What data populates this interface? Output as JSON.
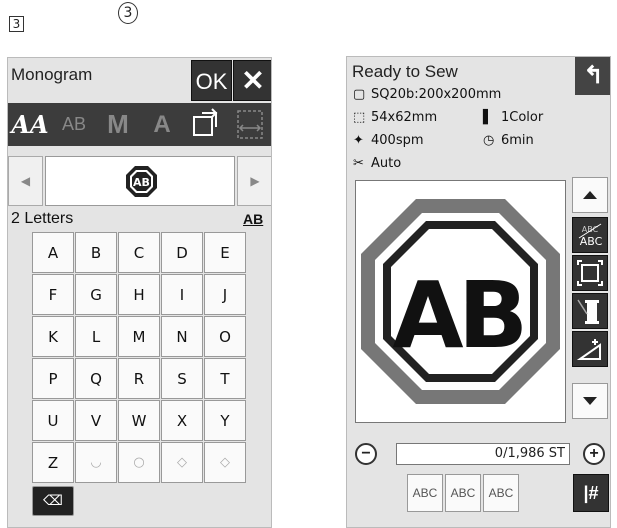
{
  "markers": {
    "step_box": "3",
    "step_circle": "3"
  },
  "monogram": {
    "title": "Monogram",
    "ok_label": "OK",
    "close_label": "✕",
    "toolbar": {
      "font_icon_label": "AA",
      "ab_icon_label": "AB",
      "m_icon_label": "M",
      "a_icon_label": "A"
    },
    "preview_text": "AB",
    "letters_count": "2 Letters",
    "ab_label": "AB",
    "arrow_left": "◀",
    "arrow_right": "▶",
    "keys": [
      [
        "A",
        "B",
        "C",
        "D",
        "E"
      ],
      [
        "F",
        "G",
        "H",
        "I",
        "J"
      ],
      [
        "K",
        "L",
        "M",
        "N",
        "O"
      ],
      [
        "P",
        "Q",
        "R",
        "S",
        "T"
      ],
      [
        "U",
        "V",
        "W",
        "X",
        "Y"
      ],
      [
        "Z",
        "◡",
        "○",
        "◇",
        "◇"
      ]
    ],
    "delete_icon": "⌫"
  },
  "ready": {
    "title": "Ready to Sew",
    "back_icon": "↰",
    "hoop": "SQ20b:200x200mm",
    "size": "54x62mm",
    "colors": "1Color",
    "speed": "400spm",
    "time": "6min",
    "thread_cut": "Auto",
    "design_left_letter": "A",
    "design_right_letter": "B",
    "design_center": "+",
    "stitch_count": "0/1,986 ST",
    "zoom_minus": "−",
    "zoom_plus": "+",
    "abc_buttons": [
      "ABC",
      "ABC",
      "ABC"
    ],
    "hash_label": "|#"
  },
  "colors": {
    "panel_bg": "#e4e4e4",
    "dark_btn": "#333333",
    "toolbar": "#3c3c3c"
  }
}
